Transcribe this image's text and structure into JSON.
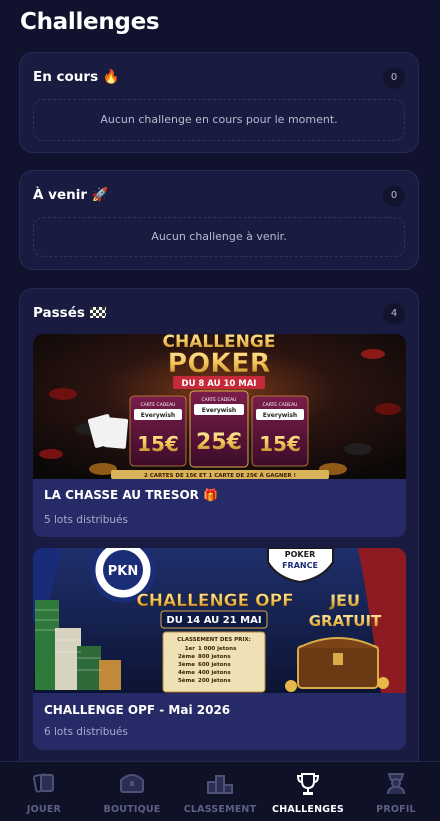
{
  "page": {
    "title": "Challenges"
  },
  "sections": {
    "en_cours": {
      "title": "En cours",
      "emoji": "🔥",
      "count": "0",
      "empty_text": "Aucun challenge en cours pour le moment."
    },
    "a_venir": {
      "title": "À venir",
      "emoji": "🚀",
      "count": "0",
      "empty_text": "Aucun challenge à venir."
    },
    "passes": {
      "title": "Passés",
      "emoji": "🏁",
      "count": "4"
    }
  },
  "cards": [
    {
      "title": "LA CHASSE AU TRESOR",
      "title_emoji": "🎁",
      "subtitle": "5 lots distribués",
      "banner": {
        "line1": "CHALLENGE",
        "line2": "POKER",
        "dates": "DU 8 AU 10 MAI",
        "gift_label": "CARTE CADEAU",
        "brand": "Everywish",
        "amounts": [
          "15€",
          "25€",
          "15€"
        ],
        "footer": "2 CARTES DE 15€ ET 1 CARTE DE 25€ À GAGNER !"
      }
    },
    {
      "title": "CHALLENGE OPF - Mai 2026",
      "subtitle": "6 lots distribués",
      "banner": {
        "logo_left": "PKN",
        "logo_right_line1": "POKER",
        "logo_right_line2": "FRANCE",
        "headline": "CHALLENGE OPF",
        "dates": "DU 14 AU 21 MAI",
        "free_line1": "JEU",
        "free_line2": "GRATUIT",
        "ranking_title": "CLASSEMENT DES PRIX:",
        "ranking": [
          {
            "place": "1er",
            "prize": "1 000 jetons"
          },
          {
            "place": "2ème",
            "prize": "800 jetons"
          },
          {
            "place": "3ème",
            "prize": "600 jetons"
          },
          {
            "place": "4ème",
            "prize": "400 jetons"
          },
          {
            "place": "5ème",
            "prize": "200 jetons"
          }
        ]
      }
    }
  ],
  "nav": {
    "items": [
      {
        "label": "JOUER",
        "icon": "cards-icon"
      },
      {
        "label": "BOUTIQUE",
        "icon": "chest-icon"
      },
      {
        "label": "CLASSEMENT",
        "icon": "podium-icon"
      },
      {
        "label": "CHALLENGES",
        "icon": "trophy-icon",
        "active": true
      },
      {
        "label": "PROFIL",
        "icon": "profile-icon"
      }
    ]
  },
  "colors": {
    "background": "#11132e",
    "section": "#191c40",
    "card": "#262a66",
    "accent_gold": "#f3c45a",
    "accent_red": "#c62a3a"
  }
}
